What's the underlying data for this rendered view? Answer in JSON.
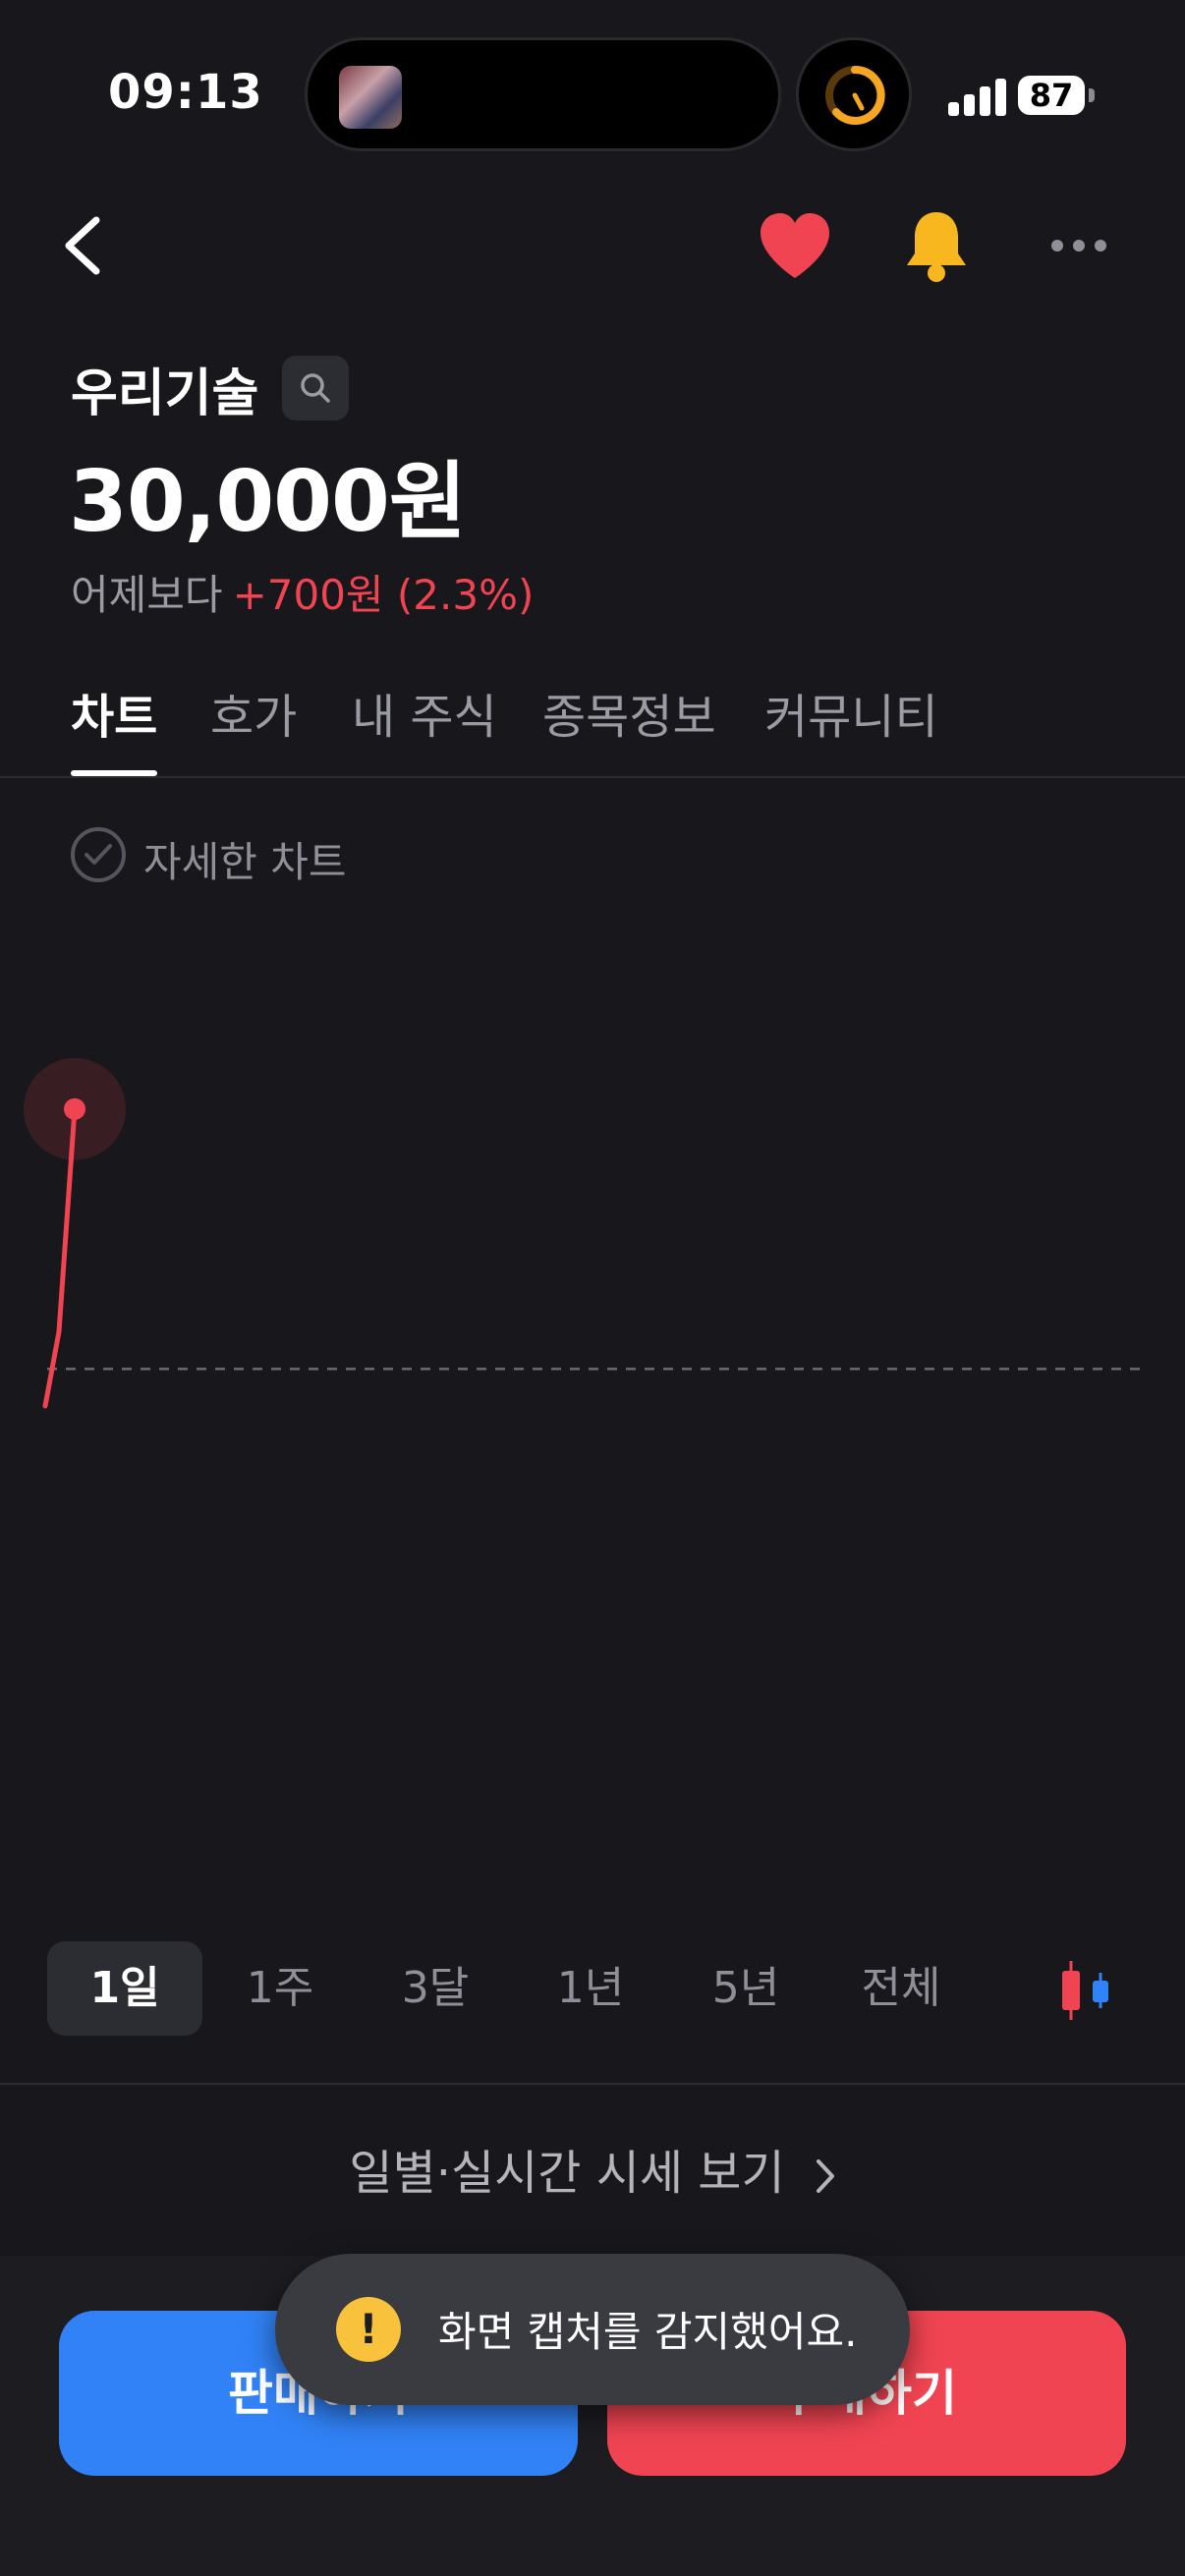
{
  "status_bar": {
    "time": "09:13",
    "battery": "87"
  },
  "stock": {
    "name": "우리기술",
    "price": "30,000원",
    "change_label": "어제보다",
    "change_value": "+700원 (2.3%)"
  },
  "tabs": [
    {
      "label": "차트",
      "active": true
    },
    {
      "label": "호가",
      "active": false
    },
    {
      "label": "내 주식",
      "active": false
    },
    {
      "label": "종목정보",
      "active": false
    },
    {
      "label": "커뮤니티",
      "active": false
    }
  ],
  "detail_chart_label": "자세한 차트",
  "ranges": [
    {
      "label": "1일",
      "active": true
    },
    {
      "label": "1주",
      "active": false
    },
    {
      "label": "3달",
      "active": false
    },
    {
      "label": "1년",
      "active": false
    },
    {
      "label": "5년",
      "active": false
    },
    {
      "label": "전체",
      "active": false
    }
  ],
  "daily_link": "일별·실시간 시세 보기",
  "buttons": {
    "sell": "판매하기",
    "buy": "구매하기"
  },
  "toast": {
    "icon": "!",
    "text": "화면 캡처를 감지했어요."
  },
  "colors": {
    "up": "#f04452",
    "sell": "#3182f6",
    "accent_heart": "#f04452",
    "accent_bell": "#f9b71f"
  },
  "chart_data": {
    "type": "line",
    "series": [
      {
        "values": [
          29200,
          29400,
          30000
        ]
      }
    ],
    "baseline": 29300
  }
}
